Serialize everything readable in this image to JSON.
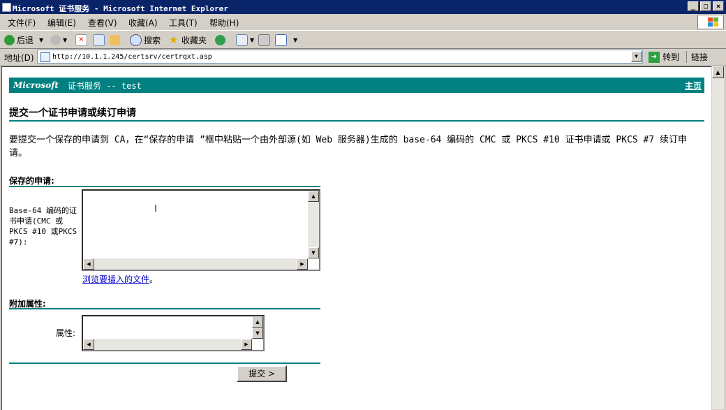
{
  "window": {
    "title": "Microsoft 证书服务 - Microsoft Internet Explorer",
    "minimize": "_",
    "maximize": "□",
    "close": "×"
  },
  "menu": [
    "文件(F)",
    "编辑(E)",
    "查看(V)",
    "收藏(A)",
    "工具(T)",
    "帮助(H)"
  ],
  "toolbar": {
    "back_label": "后退",
    "search_label": "搜索",
    "favorites_label": "收藏夹"
  },
  "address": {
    "label": "地址(D)",
    "url": "http://10.1.1.245/certsrv/certrqxt.asp",
    "go_label": "转到",
    "links_label": "链接"
  },
  "page": {
    "header_brand": "Microsoft",
    "header_service": "证书服务  --  test",
    "home_link": "主页",
    "title": "提交一个证书申请或续订申请",
    "intro": "要提交一个保存的申请到 CA，在“保存的申请 ”框中粘贴一个由外部源(如 Web 服务器)生成的 base-64 编码的 CMC 或 PKCS #10 证书申请或 PKCS #7 续订申请。",
    "saved_request_section": "保存的申请:",
    "request_field_label": "Base-64 编码的证书申请(CMC 或PKCS #10 或PKCS #7):",
    "request_value": "",
    "browse_link": "浏览要插入的文件",
    "browse_suffix": "。",
    "attributes_section": "附加属性:",
    "attributes_label": "属性:",
    "attributes_value": "",
    "submit_label": "提交 >"
  }
}
